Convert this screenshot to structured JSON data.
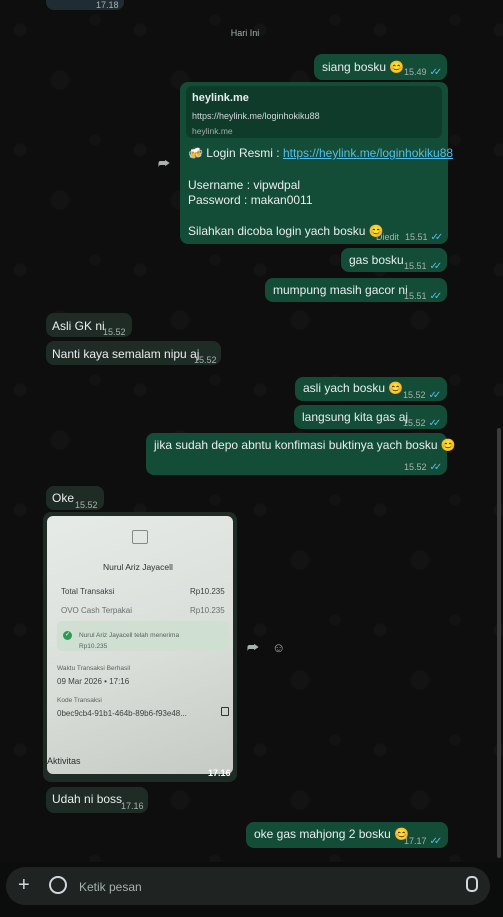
{
  "top_partial": {
    "time": "17.18"
  },
  "day_separator": "Hari Ini",
  "messages": {
    "m1": {
      "text": "siang bosku 😊",
      "time": "15.49"
    },
    "m2": {
      "preview_title": "heylink.me",
      "preview_url": "https://heylink.me/loginhokiku88",
      "preview_domain": "heylink.me",
      "login_label": "🍻 Login Resmi : ",
      "login_link": "https://heylink.me/loginhokiku88",
      "username": "Username : vipwdpal",
      "password": "Password : makan0011",
      "closing": "Silahkan dicoba login yach bosku 😊",
      "edited": "Diedit",
      "time": "15.51"
    },
    "m3": {
      "text": "gas bosku",
      "time": "15.51"
    },
    "m4": {
      "text": "mumpung masih gacor ni",
      "time": "15.51"
    },
    "m5": {
      "text": "Asli GK ni",
      "time": "15.52"
    },
    "m6": {
      "text": "Nanti kaya semalam nipu aj",
      "time": "15.52"
    },
    "m7": {
      "text": "asli yach bosku 😊",
      "time": "15.52"
    },
    "m8": {
      "text": "langsung kita gas aj",
      "time": "15.52"
    },
    "m9": {
      "text": "jika sudah depo abntu konfimasi buktinya yach bosku 😊",
      "time": "15.52"
    },
    "m10": {
      "text": "Oke",
      "time": "15.52"
    },
    "m11": {
      "time": "17.16",
      "receipt": {
        "merchant": "Nurul Ariz Jayacell",
        "total_label": "Total Transaksi",
        "total_value": "Rp10.235",
        "ovo_label": "OVO Cash Terpakai",
        "ovo_value": "Rp10.235",
        "received_text": "Nurul Ariz Jayacell telah menerima",
        "received_amount": "Rp10.235",
        "date_label": "Waktu Transaksi Berhasil",
        "date_value": "09 Mar 2026 • 17:16",
        "code_label": "Kode Transaksi",
        "code_value": "0bec9cb4-91b1-464b-89b6-f93e48...",
        "activity": "Aktivitas"
      }
    },
    "m12": {
      "text": "Udah ni boss",
      "time": "17.16"
    },
    "m13": {
      "text": "oke gas mahjong 2 bosku 😊",
      "time": "17.17"
    }
  },
  "composer": {
    "placeholder": "Ketik pesan"
  },
  "colors": {
    "outgoing": "#144d37",
    "incoming": "#1f2c25",
    "read_ticks": "#53bdeb",
    "link": "#53bdeb"
  }
}
